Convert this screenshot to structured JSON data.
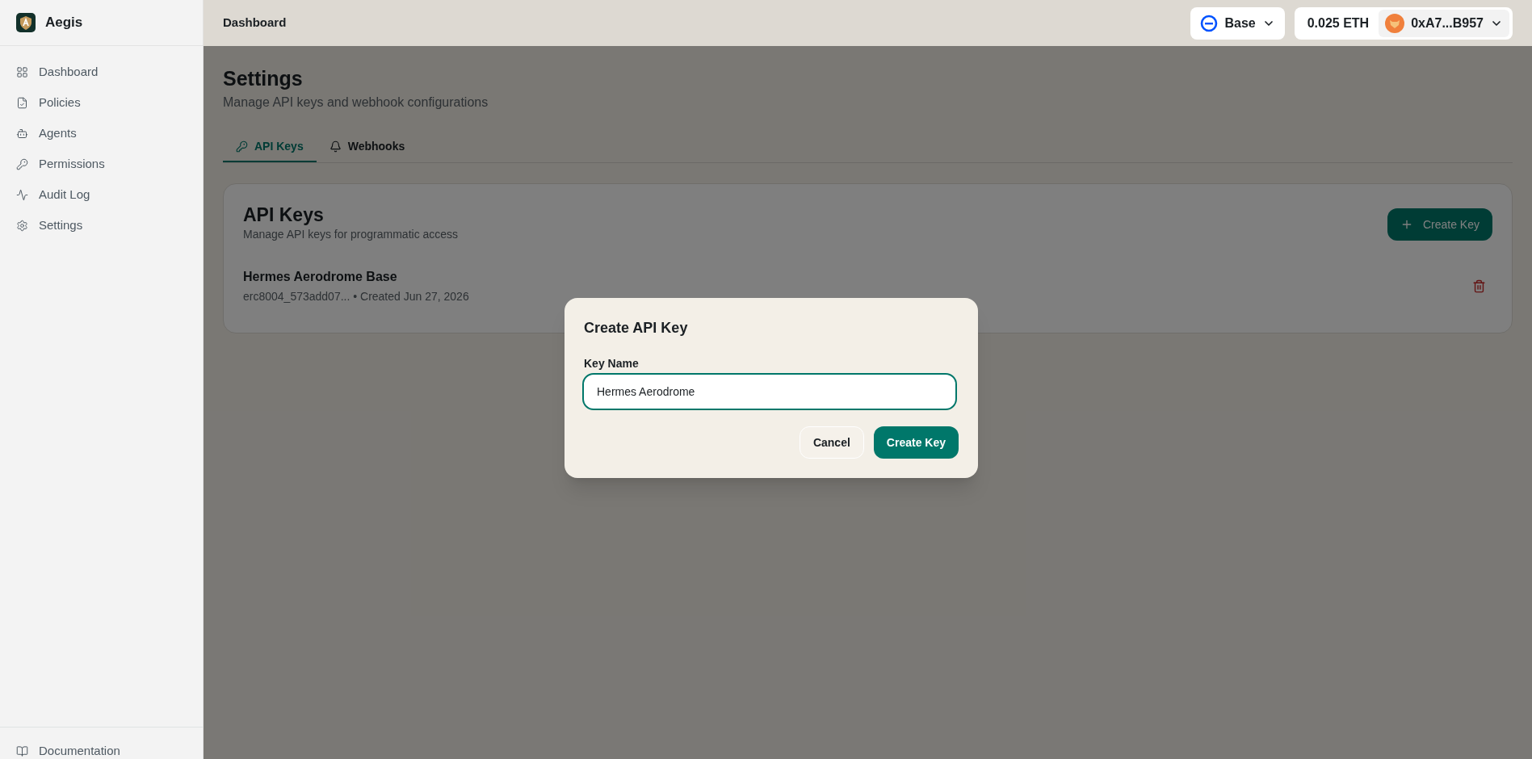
{
  "app": {
    "name": "Aegis"
  },
  "sidebar": {
    "items": [
      {
        "label": "Dashboard"
      },
      {
        "label": "Policies"
      },
      {
        "label": "Agents"
      },
      {
        "label": "Permissions"
      },
      {
        "label": "Audit Log"
      },
      {
        "label": "Settings"
      }
    ],
    "footer": {
      "label": "Documentation"
    }
  },
  "header": {
    "title": "Dashboard",
    "network": "Base",
    "balance": "0.025 ETH",
    "address": "0xA7...B957"
  },
  "page": {
    "title": "Settings",
    "subtitle": "Manage API keys and webhook configurations",
    "tabs": [
      {
        "label": "API Keys",
        "selected": true
      },
      {
        "label": "Webhooks",
        "selected": false
      }
    ],
    "card": {
      "title": "API Keys",
      "subtitle": "Manage API keys for programmatic access",
      "create_button": "Create Key",
      "keys": [
        {
          "name": "Hermes Aerodrome Base",
          "meta": "erc8004_573add07... • Created Jun 27, 2026"
        }
      ]
    }
  },
  "dialog": {
    "title": "Create API Key",
    "field_label": "Key Name",
    "field_value": "Hermes Aerodrome",
    "buttons": {
      "cancel": "Cancel",
      "confirm": "Create Key"
    }
  }
}
